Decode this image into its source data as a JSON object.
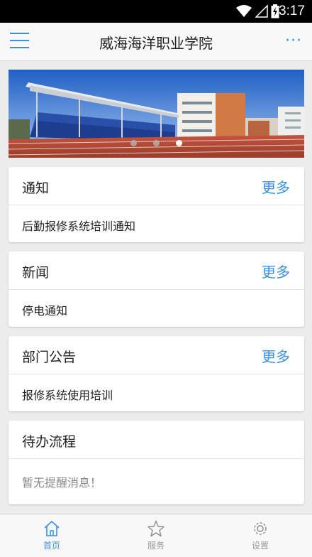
{
  "status_bar": {
    "time": "3:17"
  },
  "header": {
    "title": "威海海洋职业学院"
  },
  "banner": {
    "slide_count": 3,
    "active_slide": 3
  },
  "sections": [
    {
      "title": "通知",
      "more_label": "更多",
      "item": "后勤报修系统培训通知"
    },
    {
      "title": "新闻",
      "more_label": "更多",
      "item": "停电通知"
    },
    {
      "title": "部门公告",
      "more_label": "更多",
      "item": "报修系统使用培训"
    },
    {
      "title": "待办流程",
      "empty_message": "暂无提醒消息！"
    }
  ],
  "tabs": [
    {
      "label": "首页",
      "icon": "home-icon",
      "active": true
    },
    {
      "label": "服务",
      "icon": "star-icon",
      "active": false
    },
    {
      "label": "设置",
      "icon": "gear-icon",
      "active": false
    }
  ],
  "colors": {
    "accent": "#3b8fe0",
    "status_bar": "#000000",
    "background": "#ececec"
  }
}
